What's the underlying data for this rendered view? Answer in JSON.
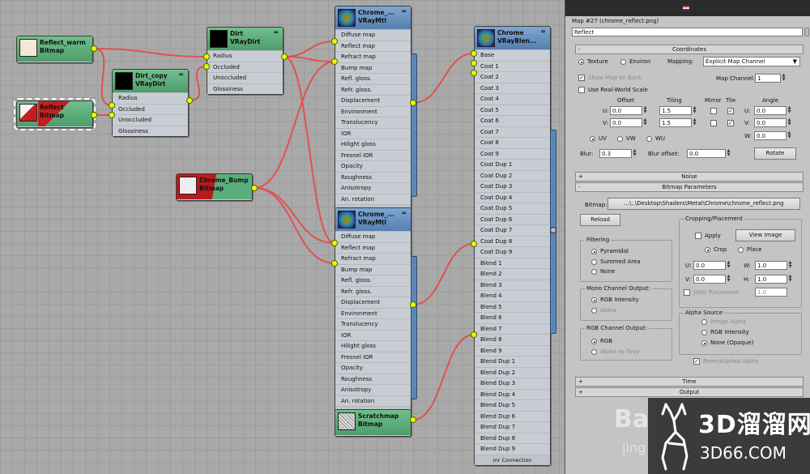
{
  "nodes": {
    "reflect_warm": {
      "title": "Reflect_warm",
      "subtitle": "Bitmap"
    },
    "reflect": {
      "title": "Reflect",
      "subtitle": "Bitmap"
    },
    "dirt_copy": {
      "title": "Dirt_copy",
      "subtitle": "VRayDirt",
      "slots": [
        "Radius",
        "Occluded",
        "Unoccluded",
        "Glossiness"
      ]
    },
    "dirt": {
      "title": "Dirt",
      "subtitle": "VRayDirt",
      "slots": [
        "Radius",
        "Occluded",
        "Unoccluded",
        "Glossiness"
      ]
    },
    "chrome_bump": {
      "title": "Chrome_Bump",
      "subtitle": "Bitmap"
    },
    "chrome_mtl_1": {
      "title": "Chrome_...",
      "subtitle": "VRayMtl"
    },
    "chrome_mtl_2": {
      "title": "Chrome_...",
      "subtitle": "VRayMtl"
    },
    "mtl_slots": [
      "Diffuse map",
      "Reflect map",
      "Refract map",
      "Bump map",
      "Refl. gloss.",
      "Refr. gloss.",
      "Displacement",
      "Environment",
      "Translucency",
      "IOR",
      "Hilight gloss",
      "Fresnel IOR",
      "Opacity",
      "Roughness",
      "Anisotropy",
      "An. rotation"
    ],
    "mtl_footer": "mr Connection",
    "scratchmap": {
      "title": "Scratchmap",
      "subtitle": "Bitmap"
    },
    "chrome_blend": {
      "title": "Chrome",
      "subtitle": "VRayBlen..."
    },
    "blend_slots": [
      "Base",
      "Coat 1",
      "Coat 2",
      "Coat 3",
      "Coat 4",
      "Coat 5",
      "Coat 6",
      "Coat 7",
      "Coat 8",
      "Coat 9",
      "Coat Dup 1",
      "Coat Dup 2",
      "Coat Dup 3",
      "Coat Dup 4",
      "Coat Dup 5",
      "Coat Dup 6",
      "Coat Dup 7",
      "Coat Dup 8",
      "Coat Dup 9",
      "Blend 1",
      "Blend 2",
      "Blend 3",
      "Blend 4",
      "Blend 5",
      "Blend 6",
      "Blend 7",
      "Blend 8",
      "Blend 9",
      "Blend Dup 1",
      "Blend Dup 2",
      "Blend Dup 3",
      "Blend Dup 4",
      "Blend Dup 5",
      "Blend Dup 6",
      "Blend Dup 7",
      "Blend Dup 8",
      "Blend Dup 9"
    ],
    "blend_footer": "mr Connection",
    "dash": "="
  },
  "panel": {
    "header": "Map #27 (chrome_reflect.png)",
    "name_value": "Reflect",
    "coordinates": {
      "rollout": "Coordinates",
      "texture": "Texture",
      "environ": "Environ",
      "mapping_label": "Mapping:",
      "mapping_value": "Explicit Map Channel",
      "show_map_on_back": "Show Map on Back",
      "map_channel_label": "Map Channel:",
      "map_channel_value": "1",
      "real_world": "Use Real-World Scale",
      "col_offset": "Offset",
      "col_tiling": "Tiling",
      "col_mirror": "Mirror",
      "col_tile": "Tile",
      "col_angle": "Angle",
      "u_label": "U:",
      "v_label": "V:",
      "w_label": "W:",
      "u_offset": "0.0",
      "v_offset": "0.0",
      "u_tiling": "1.5",
      "v_tiling": "1.5",
      "u_angle": "0.0",
      "v_angle": "0.0",
      "w_angle": "0.0",
      "uv": "UV",
      "vw": "VW",
      "wu": "WU",
      "blur_label": "Blur:",
      "blur_value": "0.3",
      "blur_offset_label": "Blur offset:",
      "blur_offset_value": "0.0",
      "rotate": "Rotate"
    },
    "noise": {
      "rollout": "Noise"
    },
    "bitmap_params": {
      "rollout": "Bitmap Parameters",
      "bitmap_label": "Bitmap:",
      "bitmap_path": "...\\..\\Desktop\\Shaders\\Metal\\Chrome\\chrome_reflect.png",
      "reload": "Reload",
      "cropping": "Cropping/Placement",
      "apply": "Apply",
      "view_image": "View Image",
      "crop": "Crop",
      "place": "Place",
      "u_label": "U:",
      "v_label": "V:",
      "w_label": "W:",
      "h_label": "H:",
      "u_value": "0.0",
      "v_value": "0.0",
      "w_value": "1.0",
      "h_value": "1.0",
      "jitter": "Jitter Placement:",
      "jitter_value": "1.0",
      "filtering": "Filtering",
      "pyramidal": "Pyramidal",
      "summed_area": "Summed Area",
      "none": "None",
      "mono_output": "Mono Channel Output:",
      "rgb_intensity": "RGB Intensity",
      "alpha": "Alpha",
      "rgb_output": "RGB Channel Output:",
      "rgb": "RGB",
      "alpha_as_gray": "Alpha as Gray",
      "alpha_source": "Alpha Source",
      "image_alpha": "Image Alpha",
      "rgb_intensity2": "RGB Intensity",
      "none_opaque": "None (Opaque)",
      "premultiplied": "Premultiplied Alpha"
    },
    "time": {
      "rollout": "Time"
    },
    "output": {
      "rollout": "Output"
    },
    "plus": "+",
    "minus": "-"
  },
  "watermark": {
    "logo_text": "3D溜溜网",
    "logo_url": "3D66.COM",
    "baidu": "Ba",
    "jing": "jing"
  },
  "colors": {
    "wire": "#e0524f",
    "node_green": "#5aae7a",
    "node_blue": "#6a93c2",
    "port": "#e6ff00"
  }
}
